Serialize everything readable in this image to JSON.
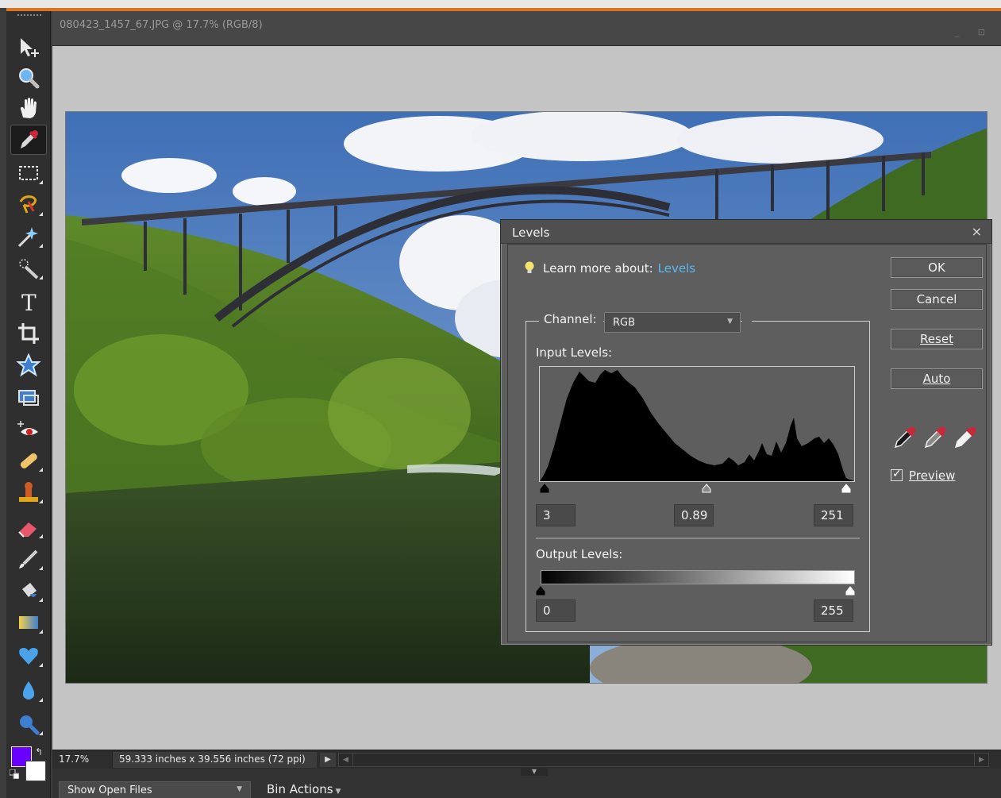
{
  "document": {
    "title": "080423_1457_67.JPG @ 17.7% (RGB/8)",
    "window_controls": "_ ⊡"
  },
  "toolbox": {
    "tools": [
      {
        "name": "move-tool-icon"
      },
      {
        "name": "zoom-tool-icon"
      },
      {
        "name": "hand-tool-icon"
      },
      {
        "name": "eyedropper-tool-icon",
        "active": true
      },
      {
        "name": "rectangular-marquee-tool-icon"
      },
      {
        "name": "lasso-tool-icon"
      },
      {
        "name": "magic-wand-tool-icon"
      },
      {
        "name": "selection-brush-tool-icon"
      },
      {
        "name": "type-tool-icon"
      },
      {
        "name": "crop-tool-icon"
      },
      {
        "name": "cookie-cutter-tool-icon"
      },
      {
        "name": "straighten-tool-icon"
      },
      {
        "name": "red-eye-removal-tool-icon"
      },
      {
        "name": "healing-brush-tool-icon"
      },
      {
        "name": "clone-stamp-tool-icon"
      },
      {
        "name": "eraser-tool-icon"
      },
      {
        "name": "brush-tool-icon"
      },
      {
        "name": "paint-bucket-tool-icon"
      },
      {
        "name": "gradient-tool-icon"
      },
      {
        "name": "custom-shape-tool-icon"
      },
      {
        "name": "blur-tool-icon"
      },
      {
        "name": "sponge-tool-icon"
      }
    ],
    "foreground_color": "#6a00ff",
    "background_color": "#ffffff"
  },
  "status_bar": {
    "zoom": "17.7%",
    "doc_size": "59.333 inches x 39.556 inches (72 ppi)",
    "arrow": "▶"
  },
  "bin_bar": {
    "show_open_files": "Show Open Files",
    "bin_actions": "Bin Actions"
  },
  "levels_dialog": {
    "title": "Levels",
    "close": "×",
    "learn_more_label": "Learn more about:",
    "learn_more_link": "Levels",
    "channel_label": "Channel:",
    "channel_value": "RGB",
    "input_levels_label": "Input Levels:",
    "input_black": "3",
    "input_gamma": "0.89",
    "input_white": "251",
    "output_levels_label": "Output Levels:",
    "output_black": "0",
    "output_white": "255",
    "buttons": {
      "ok": "OK",
      "cancel": "Cancel",
      "reset": "Reset",
      "auto": "Auto"
    },
    "preview_label": "Preview",
    "preview_checked": true
  }
}
